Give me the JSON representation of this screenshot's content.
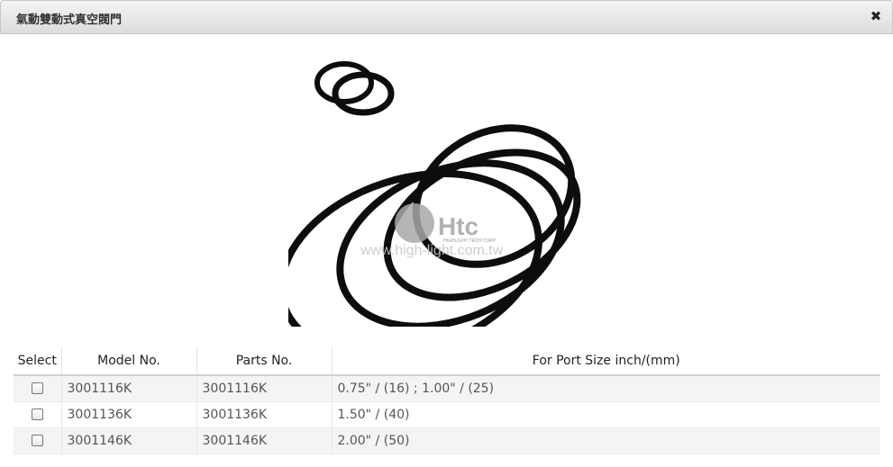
{
  "dialog": {
    "title": "氣動雙動式真空閥門",
    "close_symbol": "✖"
  },
  "image": {
    "logo_text": "Htc",
    "logo_subtext": "HIGHLIGHT TECH CORP.",
    "watermark_url": "www.high-light.com.tw"
  },
  "table": {
    "headers": [
      "Select",
      "Model No.",
      "Parts No.",
      "For Port Size inch/(mm)"
    ],
    "rows": [
      {
        "model": "3001116K",
        "part": "3001116K",
        "port": "0.75\" / (16) ; 1.00\" / (25)"
      },
      {
        "model": "3001136K",
        "part": "3001136K",
        "port": "1.50\" / (40)"
      },
      {
        "model": "3001146K",
        "part": "3001146K",
        "port": "2.00\" / (50)"
      }
    ]
  }
}
